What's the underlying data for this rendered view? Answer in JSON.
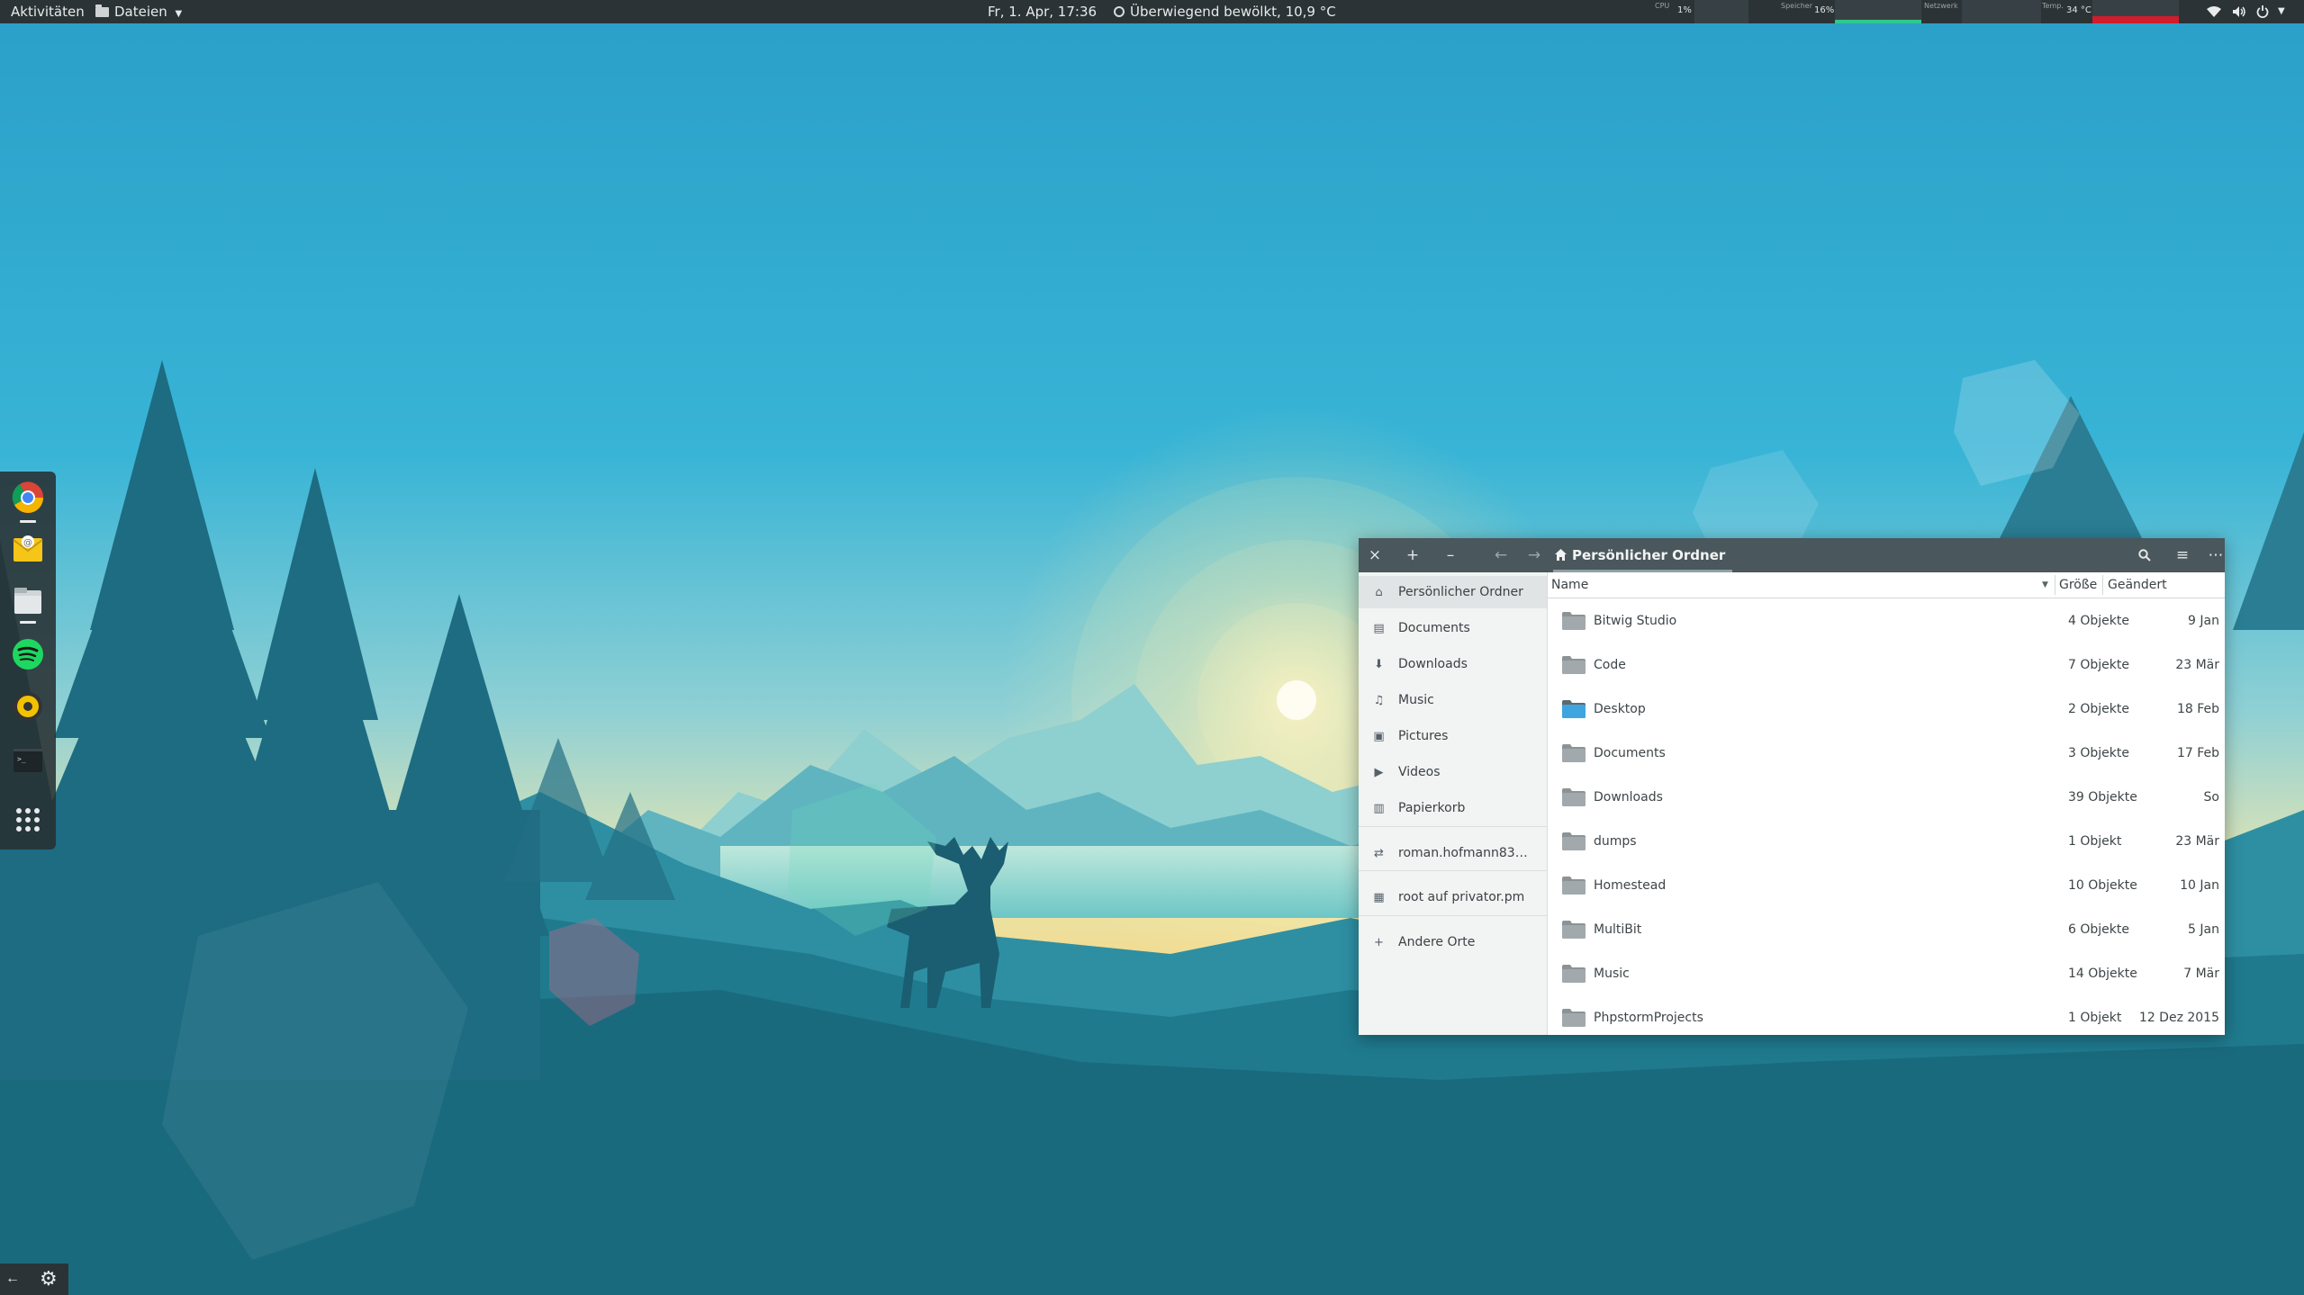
{
  "topbar": {
    "activities": "Aktivitäten",
    "app_menu": "Dateien",
    "clock": "Fr, 1. Apr, 17:36",
    "weather": "Überwiegend bewölkt, 10,9 °C",
    "monitors": {
      "cpu_label": "CPU",
      "cpu_value": "1%",
      "mem_label": "Speicher",
      "mem_value": "16%",
      "net_label": "Netzwerk",
      "temp_label": "Temp.",
      "temp_value": "34 °C"
    }
  },
  "dock": {
    "items": [
      "chrome",
      "mail",
      "files",
      "spotify",
      "rhythmbox",
      "terminal",
      "app-grid"
    ]
  },
  "window": {
    "title": "Persönlicher Ordner",
    "sidebar": [
      {
        "label": "Persönlicher Ordner",
        "icon": "home-icon"
      },
      {
        "label": "Documents",
        "icon": "document-icon"
      },
      {
        "label": "Downloads",
        "icon": "download-icon"
      },
      {
        "label": "Music",
        "icon": "music-icon"
      },
      {
        "label": "Pictures",
        "icon": "picture-icon"
      },
      {
        "label": "Videos",
        "icon": "video-icon"
      },
      {
        "label": "Papierkorb",
        "icon": "trash-icon"
      },
      {
        "label": "roman.hofmann83@g...",
        "icon": "network-icon"
      },
      {
        "label": "root auf privator.pm",
        "icon": "server-icon"
      },
      {
        "label": "Andere Orte",
        "icon": "plus-icon"
      }
    ],
    "columns": {
      "name": "Name",
      "size": "Größe",
      "modified": "Geändert"
    },
    "files": [
      {
        "name": "Bitwig Studio",
        "size": "4 Objekte",
        "modified": "9 Jan",
        "desktop": false
      },
      {
        "name": "Code",
        "size": "7 Objekte",
        "modified": "23 Mär",
        "desktop": false
      },
      {
        "name": "Desktop",
        "size": "2 Objekte",
        "modified": "18 Feb",
        "desktop": true
      },
      {
        "name": "Documents",
        "size": "3 Objekte",
        "modified": "17 Feb",
        "desktop": false
      },
      {
        "name": "Downloads",
        "size": "39 Objekte",
        "modified": "So",
        "desktop": false
      },
      {
        "name": "dumps",
        "size": "1 Objekt",
        "modified": "23 Mär",
        "desktop": false
      },
      {
        "name": "Homestead",
        "size": "10 Objekte",
        "modified": "10 Jan",
        "desktop": false
      },
      {
        "name": "MultiBit",
        "size": "6 Objekte",
        "modified": "5 Jan",
        "desktop": false
      },
      {
        "name": "Music",
        "size": "14 Objekte",
        "modified": "7 Mär",
        "desktop": false
      },
      {
        "name": "PhpstormProjects",
        "size": "1 Objekt",
        "modified": "12 Dez 2015",
        "desktop": false
      }
    ]
  }
}
